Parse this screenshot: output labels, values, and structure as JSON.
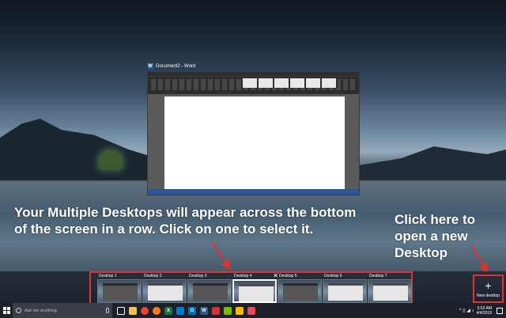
{
  "window": {
    "title": "Document2 - Word",
    "icon_letter": "W"
  },
  "annotations": {
    "main": "Your Multiple Desktops will appear across the bottom of the screen in a row. Click on one to select it.",
    "new_desktop": "Click here to open a new Desktop"
  },
  "task_view": {
    "desktops": [
      {
        "label": "Desktop 1",
        "active": false
      },
      {
        "label": "Desktop 2",
        "active": false
      },
      {
        "label": "Desktop 3",
        "active": false
      },
      {
        "label": "Desktop 4",
        "active": true
      },
      {
        "label": "Desktop 5",
        "active": false
      },
      {
        "label": "Desktop 6",
        "active": false
      },
      {
        "label": "Desktop 7",
        "active": false
      }
    ],
    "close_glyph": "✕",
    "new_desktop": {
      "plus": "+",
      "label": "New desktop"
    }
  },
  "taskbar": {
    "search_placeholder": "Ask me anything",
    "apps": [
      {
        "name": "task-view-icon",
        "color": "#ffffff",
        "glyph": ""
      },
      {
        "name": "file-explorer-icon",
        "color": "#f2c14e",
        "glyph": ""
      },
      {
        "name": "chrome-icon",
        "color": "#e94235",
        "glyph": ""
      },
      {
        "name": "firefox-icon",
        "color": "#ff7a1a",
        "glyph": ""
      },
      {
        "name": "excel-icon",
        "color": "#1f7244",
        "glyph": "X"
      },
      {
        "name": "store-icon",
        "color": "#0078d7",
        "glyph": ""
      },
      {
        "name": "outlook-icon",
        "color": "#0072c6",
        "glyph": "O"
      },
      {
        "name": "word-icon",
        "color": "#2b579a",
        "glyph": "W"
      },
      {
        "name": "app-icon",
        "color": "#d13438",
        "glyph": ""
      },
      {
        "name": "app-icon-2",
        "color": "#7fba00",
        "glyph": ""
      },
      {
        "name": "paint-icon",
        "color": "#ffb900",
        "glyph": ""
      },
      {
        "name": "app-icon-3",
        "color": "#e74856",
        "glyph": ""
      }
    ],
    "tray_glyphs": "^ ▯ ◢ ♪",
    "time": "5:52 AM",
    "date": "4/4/2018"
  }
}
